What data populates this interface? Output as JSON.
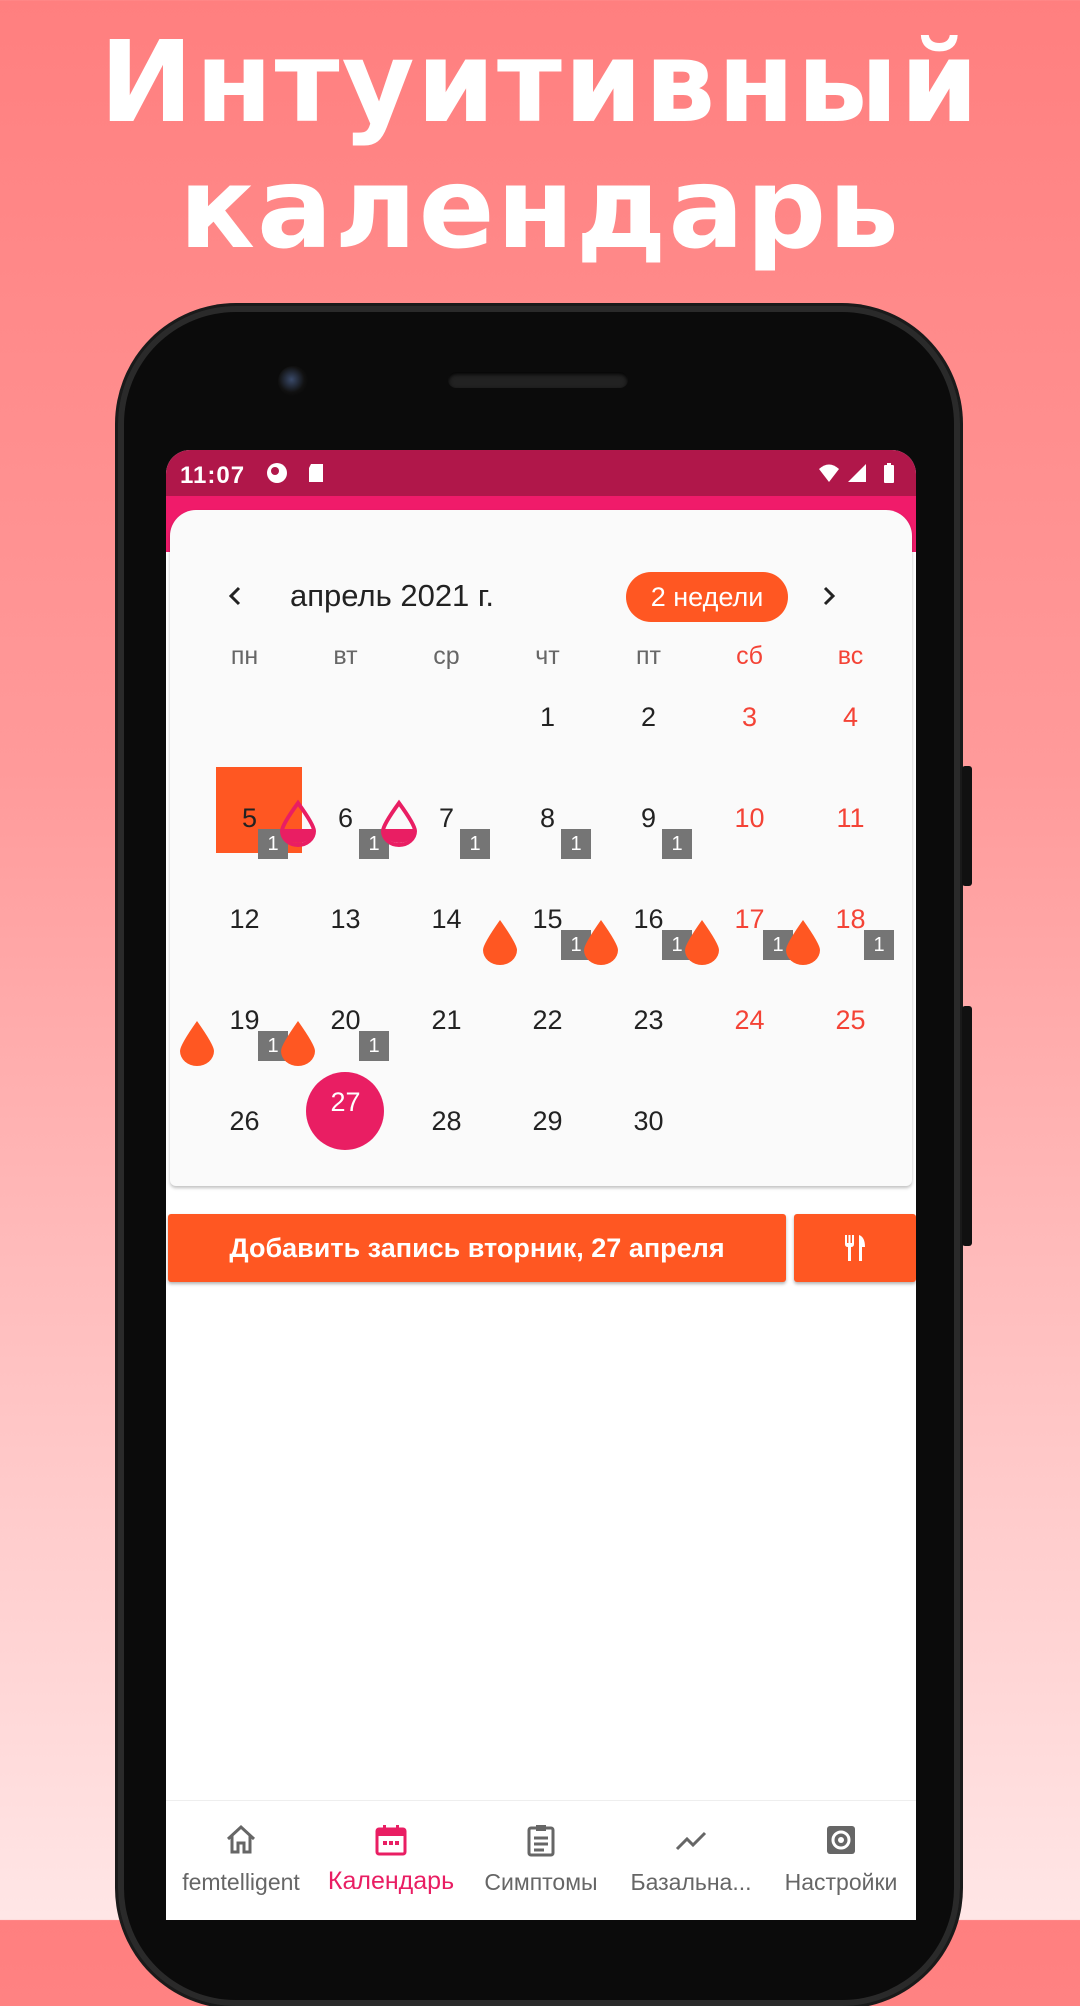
{
  "headline": {
    "line1": "Интуитивный",
    "line2": "календарь"
  },
  "status_bar": {
    "time": "11:07"
  },
  "calendar": {
    "month_title": "апрель 2021 г.",
    "view_toggle": "2 недели",
    "weekdays": [
      "пн",
      "вт",
      "ср",
      "чт",
      "пт",
      "сб",
      "вс"
    ],
    "days": [
      {
        "day": "1"
      },
      {
        "day": "2"
      },
      {
        "day": "3"
      },
      {
        "day": "4"
      },
      {
        "day": "5",
        "badge": "1",
        "selected": true
      },
      {
        "day": "6",
        "badge": "1",
        "icon": "half-drop-icon"
      },
      {
        "day": "7",
        "badge": "1",
        "icon": "half-drop-icon"
      },
      {
        "day": "8",
        "badge": "1"
      },
      {
        "day": "9",
        "badge": "1"
      },
      {
        "day": "10"
      },
      {
        "day": "11"
      },
      {
        "day": "12"
      },
      {
        "day": "13"
      },
      {
        "day": "14"
      },
      {
        "day": "15",
        "badge": "1",
        "icon": "drop-icon"
      },
      {
        "day": "16",
        "badge": "1",
        "icon": "drop-icon"
      },
      {
        "day": "17",
        "badge": "1",
        "icon": "drop-icon"
      },
      {
        "day": "18",
        "badge": "1",
        "icon": "drop-icon"
      },
      {
        "day": "19",
        "badge": "1",
        "icon": "drop-icon"
      },
      {
        "day": "20",
        "badge": "1",
        "icon": "drop-icon"
      },
      {
        "day": "21"
      },
      {
        "day": "22"
      },
      {
        "day": "23"
      },
      {
        "day": "24"
      },
      {
        "day": "25"
      },
      {
        "day": "26"
      },
      {
        "day": "27",
        "today": true
      },
      {
        "day": "28"
      },
      {
        "day": "29"
      },
      {
        "day": "30"
      }
    ]
  },
  "actions": {
    "add_entry": "Добавить запись вторник, 27 апреля",
    "food_icon": "fork-knife-icon"
  },
  "bottom_nav": [
    {
      "label": "femtelligent",
      "icon": "home-icon"
    },
    {
      "label": "Календарь",
      "icon": "calendar-icon",
      "active": true
    },
    {
      "label": "Симптомы",
      "icon": "clipboard-icon"
    },
    {
      "label": "Базальна...",
      "icon": "trend-icon"
    },
    {
      "label": "Настройки",
      "icon": "gear-icon"
    }
  ],
  "colors": {
    "accent": "#ff5722",
    "primary": "#e91e63",
    "statusbar": "#b0174a",
    "weekend": "#f44336"
  }
}
